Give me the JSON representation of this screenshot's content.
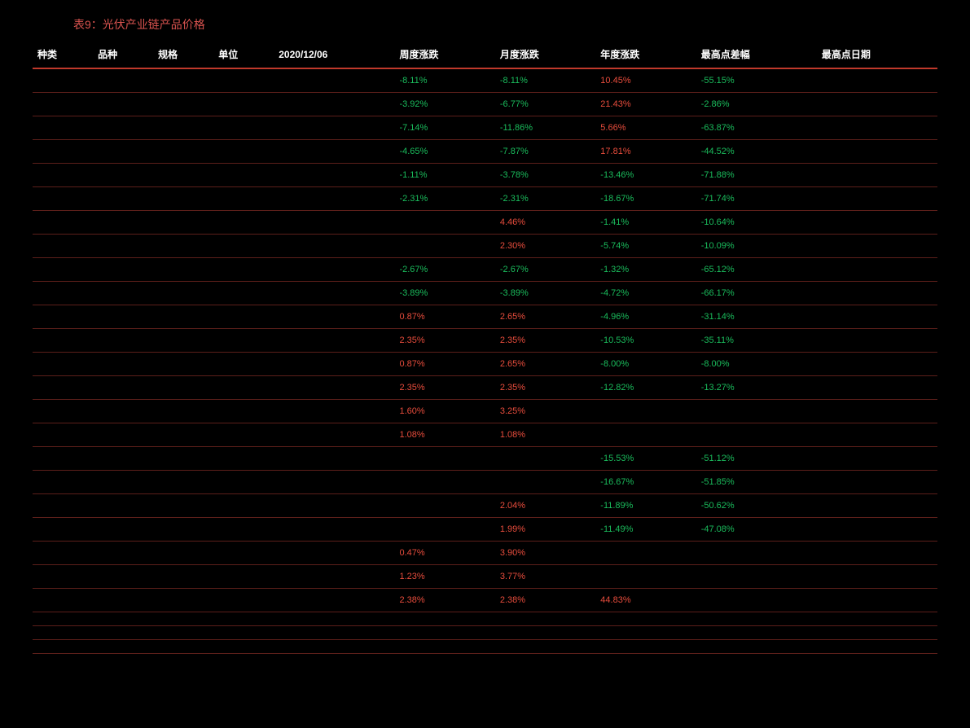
{
  "title": "表9：光伏产业链产品价格",
  "headers": [
    "种类",
    "品种",
    "规格",
    "单位",
    "2020/12/06",
    "周度涨跌",
    "月度涨跌",
    "年度涨跌",
    "最高点差幅",
    "最高点日期"
  ],
  "rows": [
    {
      "week": "-8.11%",
      "month": "-8.11%",
      "year": "10.45%",
      "peak": "-55.15%"
    },
    {
      "week": "-3.92%",
      "month": "-6.77%",
      "year": "21.43%",
      "peak": "-2.86%"
    },
    {
      "week": "-7.14%",
      "month": "-11.86%",
      "year": "5.66%",
      "peak": "-63.87%"
    },
    {
      "week": "-4.65%",
      "month": "-7.87%",
      "year": "17.81%",
      "peak": "-44.52%"
    },
    {
      "week": "-1.11%",
      "month": "-3.78%",
      "year": "-13.46%",
      "peak": "-71.88%"
    },
    {
      "week": "-2.31%",
      "month": "-2.31%",
      "year": "-18.67%",
      "peak": "-71.74%"
    },
    {
      "week": "",
      "month": "4.46%",
      "year": "-1.41%",
      "peak": "-10.64%"
    },
    {
      "week": "",
      "month": "2.30%",
      "year": "-5.74%",
      "peak": "-10.09%"
    },
    {
      "week": "-2.67%",
      "month": "-2.67%",
      "year": "-1.32%",
      "peak": "-65.12%"
    },
    {
      "week": "-3.89%",
      "month": "-3.89%",
      "year": "-4.72%",
      "peak": "-66.17%"
    },
    {
      "week": "0.87%",
      "month": "2.65%",
      "year": "-4.96%",
      "peak": "-31.14%"
    },
    {
      "week": "2.35%",
      "month": "2.35%",
      "year": "-10.53%",
      "peak": "-35.11%"
    },
    {
      "week": "0.87%",
      "month": "2.65%",
      "year": "-8.00%",
      "peak": "-8.00%"
    },
    {
      "week": "2.35%",
      "month": "2.35%",
      "year": "-12.82%",
      "peak": "-13.27%"
    },
    {
      "week": "1.60%",
      "month": "3.25%",
      "year": "",
      "peak": ""
    },
    {
      "week": "1.08%",
      "month": "1.08%",
      "year": "",
      "peak": ""
    },
    {
      "week": "",
      "month": "",
      "year": "-15.53%",
      "peak": "-51.12%"
    },
    {
      "week": "",
      "month": "",
      "year": "-16.67%",
      "peak": "-51.85%"
    },
    {
      "week": "",
      "month": "2.04%",
      "year": "-11.89%",
      "peak": "-50.62%"
    },
    {
      "week": "",
      "month": "1.99%",
      "year": "-11.49%",
      "peak": "-47.08%"
    },
    {
      "week": "0.47%",
      "month": "3.90%",
      "year": "",
      "peak": ""
    },
    {
      "week": "1.23%",
      "month": "3.77%",
      "year": "",
      "peak": ""
    },
    {
      "week": "2.38%",
      "month": "2.38%",
      "year": "44.83%",
      "peak": ""
    },
    {
      "week": "",
      "month": "",
      "year": "",
      "peak": ""
    },
    {
      "week": "",
      "month": "",
      "year": "",
      "peak": ""
    },
    {
      "week": "",
      "month": "",
      "year": "",
      "peak": ""
    }
  ]
}
